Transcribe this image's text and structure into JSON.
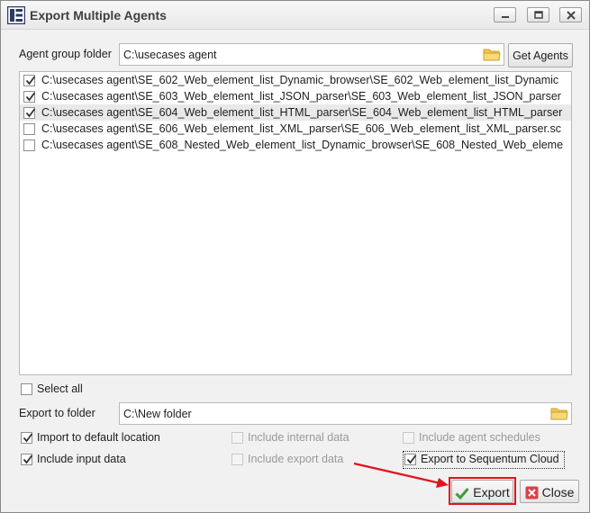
{
  "window": {
    "title": "Export Multiple Agents",
    "controls": [
      "minimize-icon",
      "maximize-icon",
      "close-icon"
    ]
  },
  "agent_group": {
    "label": "Agent group folder",
    "value": "C:\\usecases agent",
    "button": "Get Agents"
  },
  "agents": [
    {
      "path": "C:\\usecases agent\\SE_602_Web_element_list_Dynamic_browser\\SE_602_Web_element_list_Dynamic",
      "checked": true,
      "selected": false
    },
    {
      "path": "C:\\usecases agent\\SE_603_Web_element_list_JSON_parser\\SE_603_Web_element_list_JSON_parser",
      "checked": true,
      "selected": false
    },
    {
      "path": "C:\\usecases agent\\SE_604_Web_element_list_HTML_parser\\SE_604_Web_element_list_HTML_parser",
      "checked": true,
      "selected": true
    },
    {
      "path": "C:\\usecases agent\\SE_606_Web_element_list_XML_parser\\SE_606_Web_element_list_XML_parser.sc",
      "checked": false,
      "selected": false
    },
    {
      "path": "C:\\usecases agent\\SE_608_Nested_Web_element_list_Dynamic_browser\\SE_608_Nested_Web_eleme",
      "checked": false,
      "selected": false
    }
  ],
  "select_all": {
    "label": "Select all",
    "checked": false
  },
  "export_folder": {
    "label": "Export to folder",
    "value": "C:\\New folder"
  },
  "options": {
    "import_default": {
      "label": "Import to default location",
      "checked": true,
      "enabled": true
    },
    "include_input": {
      "label": "Include input data",
      "checked": true,
      "enabled": true
    },
    "include_internal": {
      "label": "Include internal data",
      "checked": false,
      "enabled": false
    },
    "include_export": {
      "label": "Include export data",
      "checked": false,
      "enabled": false
    },
    "include_schedules": {
      "label": "Include agent schedules",
      "checked": false,
      "enabled": false
    },
    "export_cloud": {
      "label": "Export to Sequentum Cloud",
      "checked": true,
      "enabled": true
    }
  },
  "buttons": {
    "export": "Export",
    "close": "Close"
  },
  "colors": {
    "highlight": "#e0141e",
    "check_green": "#3f9b3a",
    "close_red": "#d9404a",
    "folder_yellow": "#f2c94c"
  }
}
